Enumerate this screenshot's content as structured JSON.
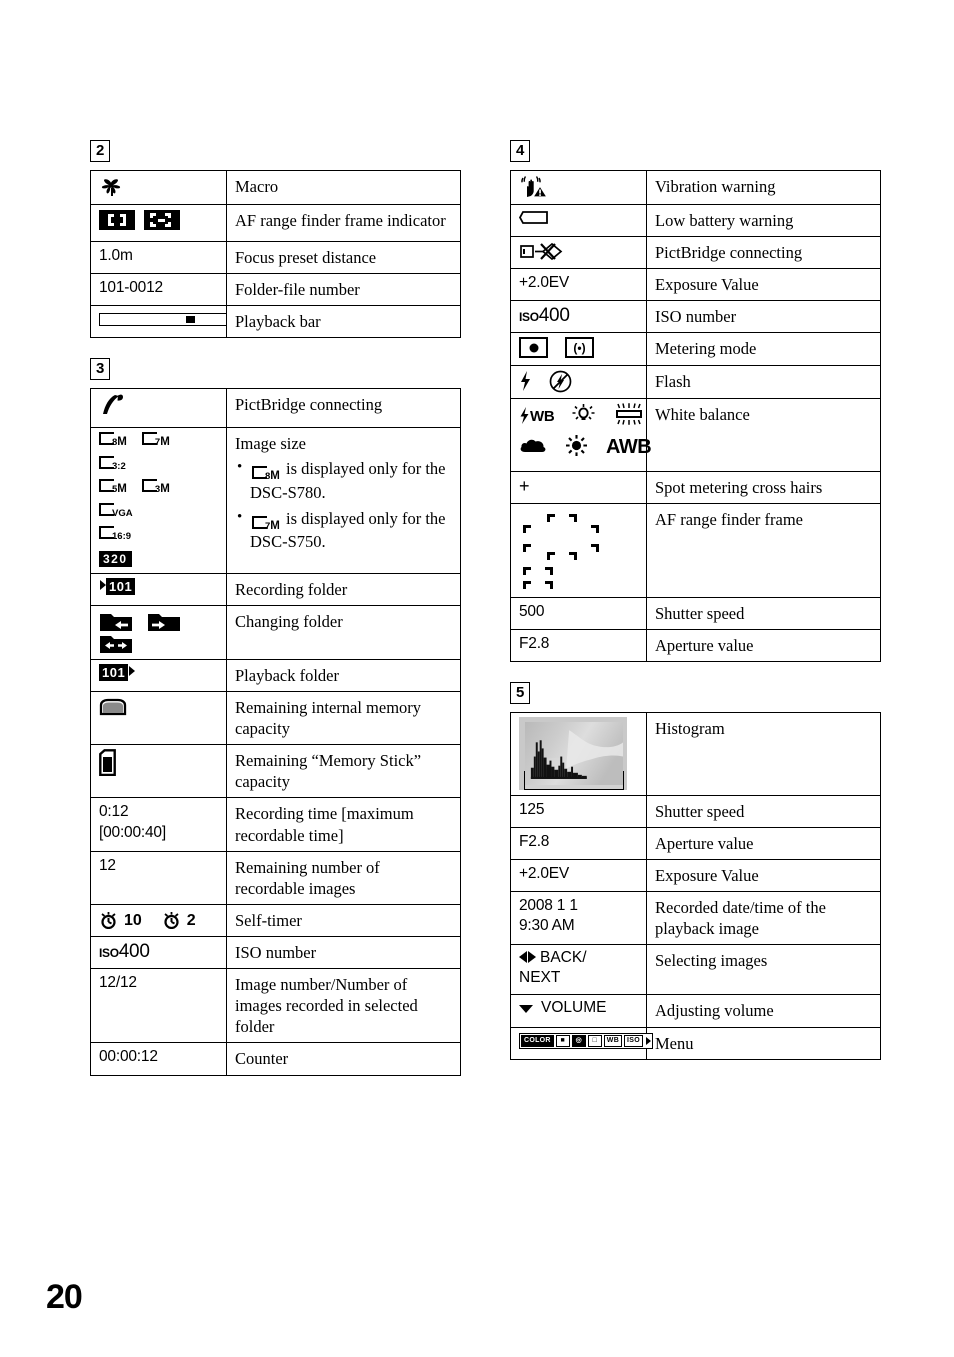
{
  "page": {
    "number": "20"
  },
  "sections": [
    {
      "badge": "2",
      "rows": [
        {
          "icon": "macro-flower-icon",
          "value": "",
          "desc": "Macro"
        },
        {
          "icon": "af-range-finder-frame-indicator-icon",
          "value": "",
          "desc": "AF range finder frame indicator"
        },
        {
          "icon": "",
          "value": "1.0m",
          "desc": "Focus preset distance"
        },
        {
          "icon": "",
          "value": "101-0012",
          "desc": "Folder-file number"
        },
        {
          "icon": "playback-bar-icon",
          "value": "",
          "desc": "Playback bar"
        }
      ]
    },
    {
      "badge": "3",
      "rows": [
        {
          "icon": "pictbridge-connecting-icon",
          "value": "",
          "desc": "PictBridge connecting"
        },
        {
          "icon": "image-size-icons",
          "value": "",
          "desc": "Image size",
          "sizes": [
            "8M",
            "7M",
            "3:2",
            "5M",
            "3M",
            "VGA",
            "16:9"
          ],
          "movie_size": "320",
          "notes": [
            {
              "pre": "",
              "icon": "8M",
              "post": " is displayed only for the DSC-S780."
            },
            {
              "pre": "",
              "icon": "7M",
              "post": " is displayed only for the DSC-S750."
            }
          ]
        },
        {
          "icon": "recording-folder-icon",
          "value": "101",
          "desc": "Recording folder"
        },
        {
          "icon": "changing-folder-icons",
          "value": "",
          "desc": "Changing folder"
        },
        {
          "icon": "playback-folder-icon",
          "value": "101",
          "desc": "Playback folder"
        },
        {
          "icon": "internal-memory-icon",
          "value": "",
          "desc": "Remaining internal memory capacity"
        },
        {
          "icon": "memory-stick-icon",
          "value": "",
          "desc": "Remaining “Memory Stick” capacity"
        },
        {
          "icon": "",
          "value": "0:12\n[00:00:40]",
          "desc": "Recording time [maximum recordable time]"
        },
        {
          "icon": "",
          "value": "12",
          "desc": "Remaining number of recordable images"
        },
        {
          "icon": "self-timer-icons",
          "value": "",
          "desc": "Self-timer",
          "timer_values": [
            "10",
            "2"
          ]
        },
        {
          "icon": "iso-icon",
          "value": "400",
          "prefix": "ISO",
          "desc": "ISO number"
        },
        {
          "icon": "",
          "value": "12/12",
          "desc": "Image number/Number of images recorded in selected folder"
        },
        {
          "icon": "",
          "value": "00:00:12",
          "desc": "Counter"
        }
      ]
    },
    {
      "badge": "4",
      "rows": [
        {
          "icon": "vibration-warning-icon",
          "value": "",
          "desc": "Vibration warning"
        },
        {
          "icon": "low-battery-warning-icon",
          "value": "",
          "desc": "Low battery warning"
        },
        {
          "icon": "pictbridge-connecting-icon",
          "value": "",
          "desc": "PictBridge connecting"
        },
        {
          "icon": "",
          "value": "+2.0EV",
          "desc": "Exposure Value"
        },
        {
          "icon": "iso-icon",
          "value": "400",
          "prefix": "ISO",
          "desc": "ISO number"
        },
        {
          "icon": "metering-mode-icons",
          "value": "",
          "desc": "Metering mode"
        },
        {
          "icon": "flash-icons",
          "value": "",
          "desc": "Flash"
        },
        {
          "icon": "white-balance-icons",
          "value": "",
          "desc": "White balance",
          "wb_labels": [
            "WB",
            "incandescent",
            "fluorescent",
            "cloudy",
            "daylight",
            "AWB"
          ]
        },
        {
          "icon": "",
          "value": "+",
          "desc": "Spot metering cross hairs"
        },
        {
          "icon": "af-range-finder-frame-icon",
          "value": "",
          "desc": "AF range finder frame"
        },
        {
          "icon": "",
          "value": "500",
          "desc": "Shutter speed"
        },
        {
          "icon": "",
          "value": "F2.8",
          "desc": "Aperture value"
        }
      ]
    },
    {
      "badge": "5",
      "rows": [
        {
          "icon": "histogram-thumbnail-icon",
          "value": "",
          "desc": "Histogram"
        },
        {
          "icon": "",
          "value": "125",
          "desc": "Shutter speed"
        },
        {
          "icon": "",
          "value": "F2.8",
          "desc": "Aperture value"
        },
        {
          "icon": "",
          "value": "+2.0EV",
          "desc": "Exposure Value"
        },
        {
          "icon": "",
          "value": "2008 1 1\n9:30 AM",
          "desc": "Recorded date/time of the playback image"
        },
        {
          "icon": "left-right-arrows-icon",
          "value": "BACK/\nNEXT",
          "desc": "Selecting images"
        },
        {
          "icon": "down-arrow-icon",
          "value": "VOLUME",
          "desc": "Adjusting volume"
        },
        {
          "icon": "menu-strip-icon",
          "value": "",
          "desc": "Menu",
          "menu_items": [
            "COLOR",
            "EV",
            "FOCUS",
            "METERING",
            "WB",
            "ISO"
          ]
        }
      ]
    }
  ]
}
